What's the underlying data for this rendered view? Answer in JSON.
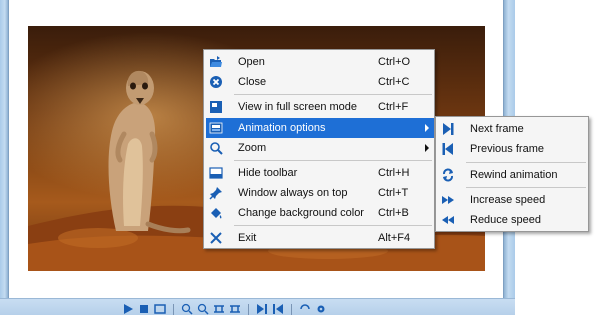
{
  "menu": {
    "items": [
      {
        "label": "Open",
        "shortcut": "Ctrl+O",
        "icon": "open-folder-icon"
      },
      {
        "label": "Close",
        "shortcut": "Ctrl+C",
        "icon": "close-circle-icon"
      },
      {
        "label": "View in full screen mode",
        "shortcut": "Ctrl+F",
        "icon": "fullscreen-icon"
      },
      {
        "label": "Animation options",
        "shortcut": "",
        "icon": "film-icon",
        "has_submenu": true,
        "highlighted": true
      },
      {
        "label": "Zoom",
        "shortcut": "",
        "icon": "magnifier-icon",
        "has_submenu": true
      },
      {
        "label": "Hide toolbar",
        "shortcut": "Ctrl+H",
        "icon": "toolbar-icon"
      },
      {
        "label": "Window always on top",
        "shortcut": "Ctrl+T",
        "icon": "pin-icon"
      },
      {
        "label": "Change background color",
        "shortcut": "Ctrl+B",
        "icon": "paint-bucket-icon"
      },
      {
        "label": "Exit",
        "shortcut": "Alt+F4",
        "icon": "exit-x-icon"
      }
    ]
  },
  "submenu": {
    "items": [
      {
        "label": "Next frame",
        "icon": "next-frame-icon"
      },
      {
        "label": "Previous frame",
        "icon": "previous-frame-icon"
      },
      {
        "label": "Rewind animation",
        "icon": "rewind-loop-icon"
      },
      {
        "label": "Increase speed",
        "icon": "fast-forward-icon"
      },
      {
        "label": "Reduce speed",
        "icon": "fast-rewind-icon"
      }
    ]
  },
  "colors": {
    "highlight": "#1e6fd6",
    "menu_bg": "#f5f5f5",
    "icon_blue": "#1a5fb4",
    "frame_blue": "#aacbe9"
  },
  "image": {
    "subject": "meerkat-photo"
  }
}
